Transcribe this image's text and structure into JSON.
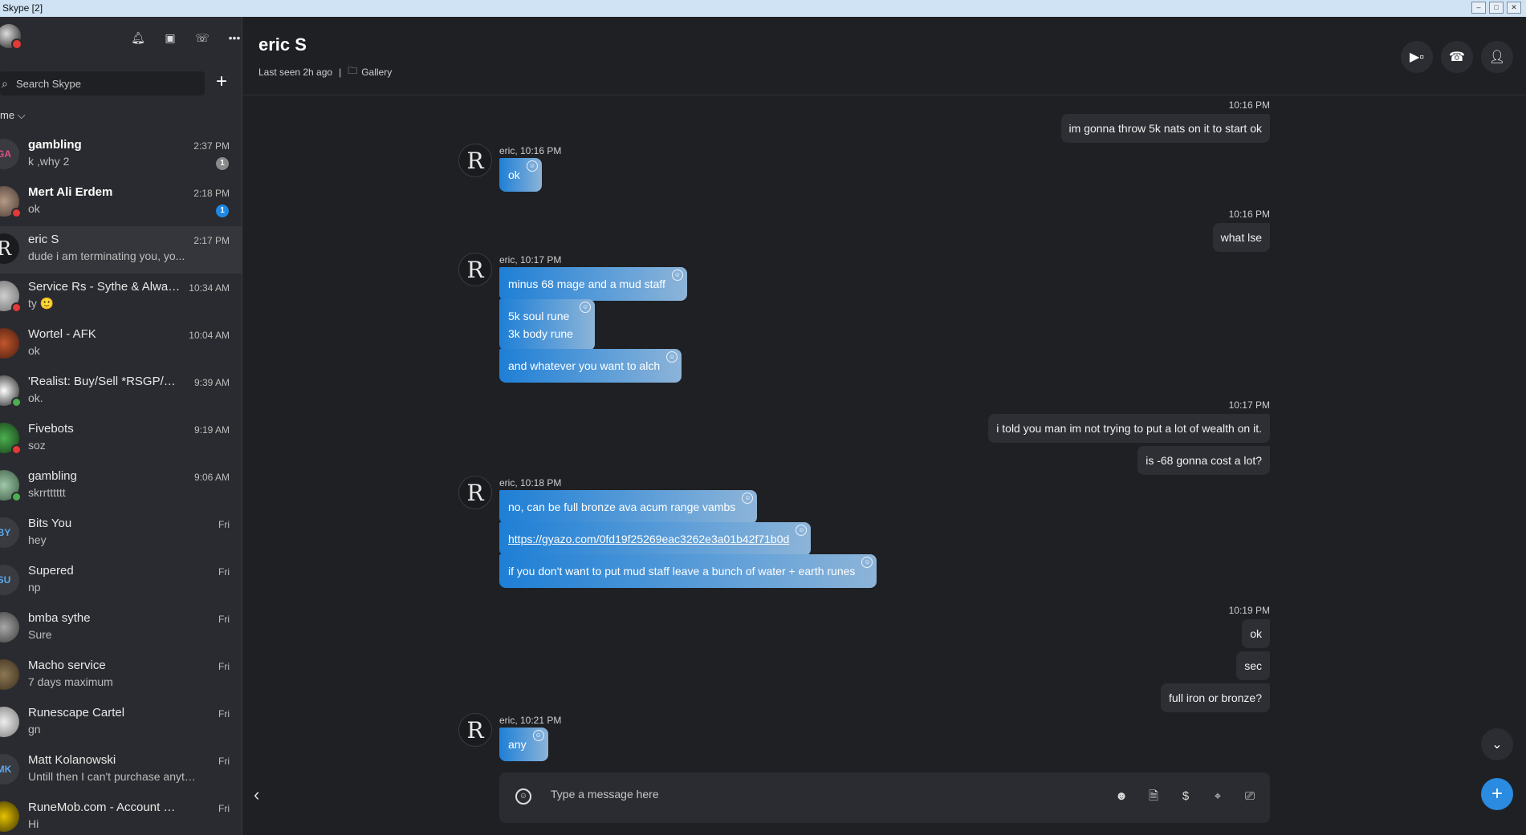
{
  "window": {
    "title": "Skype [2]"
  },
  "sidebar": {
    "search_placeholder": "Search Skype",
    "add_label": "+",
    "sort_label": "me"
  },
  "chats": [
    {
      "name": "gambling",
      "preview": "k ,why 2",
      "time": "2:37 PM",
      "badge": "1",
      "initials": "GA",
      "bold": true
    },
    {
      "name": "Mert Ali Erdem",
      "preview": "ok",
      "time": "2:18 PM",
      "badge": "1",
      "initials": "",
      "bold": true
    },
    {
      "name": "eric S",
      "preview": "dude i am terminating you, yo...",
      "time": "2:17 PM",
      "badge": "",
      "initials": "R",
      "bold": false
    },
    {
      "name": "Service Rs - Sythe & Alway...",
      "preview": "ty 🙂",
      "time": "10:34 AM",
      "badge": "",
      "initials": "",
      "bold": false
    },
    {
      "name": "Wortel - AFK",
      "preview": "ok",
      "time": "10:04 AM",
      "badge": "",
      "initials": "",
      "bold": false
    },
    {
      "name": "'Realist: Buy/Sell *RSGP/CS:...",
      "preview": "ok.",
      "time": "9:39 AM",
      "badge": "",
      "initials": "",
      "bold": false
    },
    {
      "name": "Fivebots",
      "preview": "soz",
      "time": "9:19 AM",
      "badge": "",
      "initials": "",
      "bold": false
    },
    {
      "name": "gambling",
      "preview": "skrrtttttt",
      "time": "9:06 AM",
      "badge": "",
      "initials": "",
      "bold": false
    },
    {
      "name": "Bits You",
      "preview": "hey",
      "time": "Fri",
      "badge": "",
      "initials": "BY",
      "bold": false
    },
    {
      "name": "Supered",
      "preview": "np",
      "time": "Fri",
      "badge": "",
      "initials": "SU",
      "bold": false
    },
    {
      "name": "bmba sythe",
      "preview": "Sure",
      "time": "Fri",
      "badge": "",
      "initials": "",
      "bold": false
    },
    {
      "name": "Macho service",
      "preview": "7 days maximum",
      "time": "Fri",
      "badge": "",
      "initials": "",
      "bold": false
    },
    {
      "name": "Runescape Cartel",
      "preview": "gn",
      "time": "Fri",
      "badge": "",
      "initials": "",
      "bold": false
    },
    {
      "name": "Matt Kolanowski",
      "preview": "Untill then I can't purchase anythin...",
      "time": "Fri",
      "badge": "",
      "initials": "MK",
      "bold": false
    },
    {
      "name": "RuneMob.com - Account Rentals...",
      "preview": "Hi",
      "time": "Fri",
      "badge": "",
      "initials": "",
      "bold": false
    }
  ],
  "colors": {
    "accent": "#2a8be0",
    "busy": "#e53935",
    "online": "#4caf50",
    "badge_grey": "#8a8a8a",
    "badge_blue": "#1e88e5"
  },
  "conversation": {
    "name": "eric S",
    "last_seen": "Last seen 2h ago",
    "separator": "|",
    "gallery": "Gallery",
    "avatar_letter": "R"
  },
  "messages": {
    "t1": "10:16 PM",
    "out1": "im gonna throw 5k nats on it to start ok",
    "s1": "eric, 10:16 PM",
    "in1": "ok",
    "t2": "10:16 PM",
    "out2": "what lse",
    "s2": "eric, 10:17 PM",
    "in2": "minus 68 mage and a mud staff",
    "in3a": "5k soul rune",
    "in3b": "3k body rune",
    "in4": "and whatever you want to alch",
    "t3": "10:17 PM",
    "out3": "i told you man im not trying to put a lot of wealth on it.",
    "out4": "is -68 gonna cost a lot?",
    "s3": "eric, 10:18 PM",
    "in5": "no, can be full bronze ava acum range vambs",
    "in6": "https://gyazo.com/0fd19f25269eac3262e3a01b42f71b0d",
    "in7": "if you don't want to put mud staff leave a bunch of water + earth runes",
    "t4": "10:19 PM",
    "out5": "ok",
    "out6": "sec",
    "out7": "full iron or bronze?",
    "s4": "eric, 10:21 PM",
    "in8": "any"
  },
  "composer": {
    "placeholder": "Type a message here"
  }
}
